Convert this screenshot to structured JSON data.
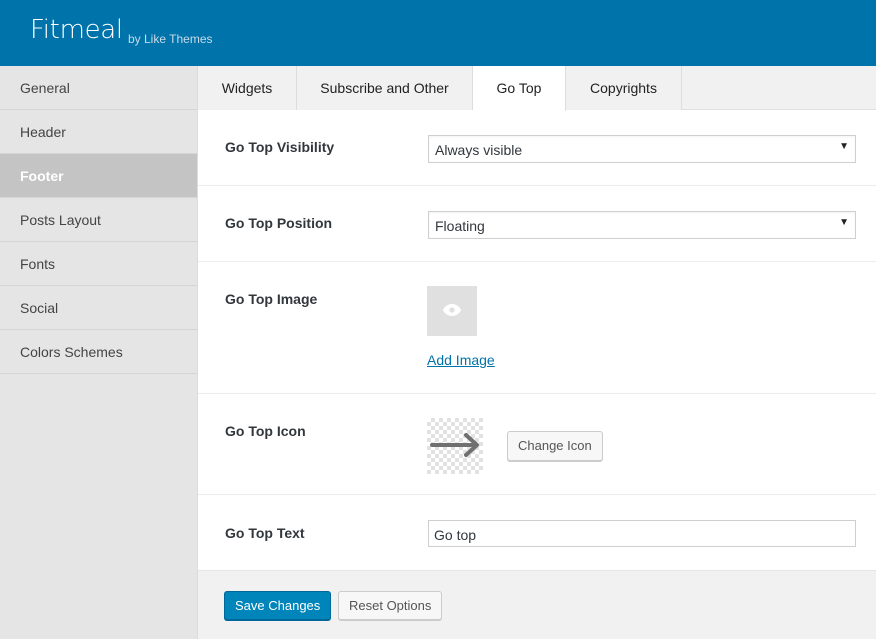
{
  "header": {
    "title": "Fitmeal",
    "subtitle": "by Like Themes",
    "background_color": "#0073aa"
  },
  "sidebar": {
    "items": [
      {
        "label": "General",
        "active": false
      },
      {
        "label": "Header",
        "active": false
      },
      {
        "label": "Footer",
        "active": true
      },
      {
        "label": "Posts Layout",
        "active": false
      },
      {
        "label": "Fonts",
        "active": false
      },
      {
        "label": "Social",
        "active": false
      },
      {
        "label": "Colors Schemes",
        "active": false
      }
    ]
  },
  "tabs": [
    {
      "label": "Widgets",
      "active": false
    },
    {
      "label": "Subscribe and Other",
      "active": false
    },
    {
      "label": "Go Top",
      "active": true
    },
    {
      "label": "Copyrights",
      "active": false
    }
  ],
  "fields": {
    "visibility": {
      "label": "Go Top Visibility",
      "value": "Always visible",
      "arrow_icon": "caret-down-icon"
    },
    "position": {
      "label": "Go Top Position",
      "value": "Floating",
      "arrow_icon": "caret-down-icon"
    },
    "image": {
      "label": "Go Top Image",
      "placeholder_icon": "eye-icon",
      "add_link": "Add Image"
    },
    "icon": {
      "label": "Go Top Icon",
      "preview_icon": "arrow-right-icon",
      "change_button": "Change Icon"
    },
    "text": {
      "label": "Go Top Text",
      "value": "Go top"
    }
  },
  "actions": {
    "save_label": "Save Changes",
    "reset_label": "Reset Options",
    "primary_color": "#0085ba"
  }
}
